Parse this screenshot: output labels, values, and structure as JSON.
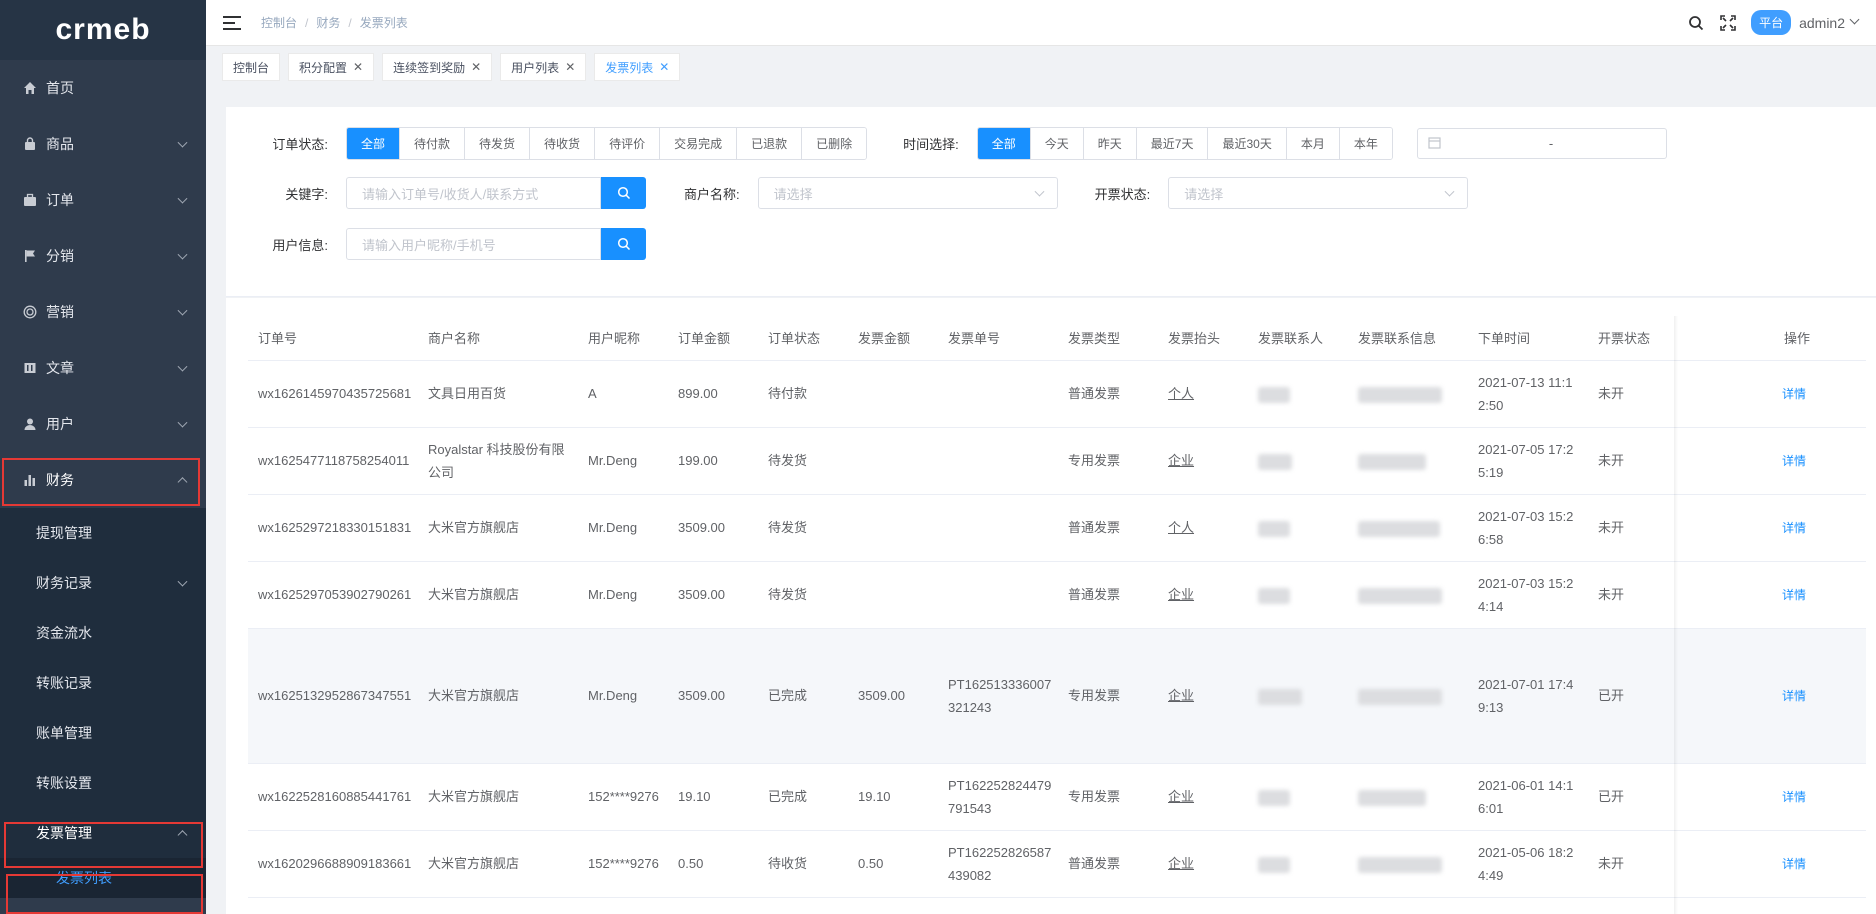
{
  "logo": "crmeb",
  "colors": {
    "accent": "#1890ff",
    "sidebar": "#2f3b4c",
    "highlight": "#e53935"
  },
  "sidebar": {
    "items": [
      {
        "label": "首页",
        "icon": "home-icon"
      },
      {
        "label": "商品",
        "icon": "bag-icon"
      },
      {
        "label": "订单",
        "icon": "briefcase-icon"
      },
      {
        "label": "分销",
        "icon": "flag-icon"
      },
      {
        "label": "营销",
        "icon": "target-icon"
      },
      {
        "label": "文章",
        "icon": "book-icon"
      },
      {
        "label": "用户",
        "icon": "user-icon"
      },
      {
        "label": "财务",
        "icon": "bar-chart-icon"
      }
    ],
    "finance_sub": [
      "提现管理",
      "财务记录",
      "资金流水",
      "转账记录",
      "账单管理",
      "转账设置",
      "发票管理"
    ],
    "invoice_sub": [
      "发票列表"
    ]
  },
  "header": {
    "breadcrumb": [
      "控制台",
      "财务",
      "发票列表"
    ],
    "platform": "平台",
    "user": "admin2"
  },
  "tags": [
    {
      "label": "控制台",
      "closable": false
    },
    {
      "label": "积分配置",
      "closable": true
    },
    {
      "label": "连续签到奖励",
      "closable": true
    },
    {
      "label": "用户列表",
      "closable": true
    },
    {
      "label": "发票列表",
      "closable": true,
      "active": true
    }
  ],
  "filters": {
    "order_status_label": "订单状态:",
    "order_status_options": [
      "全部",
      "待付款",
      "待发货",
      "待收货",
      "待评价",
      "交易完成",
      "已退款",
      "已删除"
    ],
    "time_label": "时间选择:",
    "time_options": [
      "全部",
      "今天",
      "昨天",
      "最近7天",
      "最近30天",
      "本月",
      "本年"
    ],
    "date_sep": "-",
    "keyword_label": "关键字:",
    "keyword_placeholder": "请输入订单号/收货人/联系方式",
    "merchant_label": "商户名称:",
    "merchant_placeholder": "请选择",
    "invoice_status_label": "开票状态:",
    "invoice_status_placeholder": "请选择",
    "user_label": "用户信息:",
    "user_placeholder": "请输入用户昵称/手机号"
  },
  "table": {
    "columns": [
      "订单号",
      "商户名称",
      "用户昵称",
      "订单金额",
      "订单状态",
      "发票金额",
      "发票单号",
      "发票类型",
      "发票抬头",
      "发票联系人",
      "发票联系信息",
      "下单时间",
      "开票状态",
      "操作"
    ],
    "rows": [
      {
        "order_no": "wx1626145970435725681",
        "merchant": "文具日用百货",
        "nickname": "A",
        "amount": "899.00",
        "status": "待付款",
        "inv_amount": "",
        "inv_no": "",
        "inv_type": "普通发票",
        "inv_title": "个人",
        "created": "2021-07-13 11:12:50",
        "inv_status": "未开",
        "action": "详情"
      },
      {
        "order_no": "wx1625477118758254011",
        "merchant": "Royalstar 科技股份有限公司",
        "nickname": "Mr.Deng",
        "amount": "199.00",
        "status": "待发货",
        "inv_amount": "",
        "inv_no": "",
        "inv_type": "专用发票",
        "inv_title": "企业",
        "created": "2021-07-05 17:25:19",
        "inv_status": "未开",
        "action": "详情"
      },
      {
        "order_no": "wx1625297218330151831",
        "merchant": "大米官方旗舰店",
        "nickname": "Mr.Deng",
        "amount": "3509.00",
        "status": "待发货",
        "inv_amount": "",
        "inv_no": "",
        "inv_type": "普通发票",
        "inv_title": "个人",
        "created": "2021-07-03 15:26:58",
        "inv_status": "未开",
        "action": "详情"
      },
      {
        "order_no": "wx1625297053902790261",
        "merchant": "大米官方旗舰店",
        "nickname": "Mr.Deng",
        "amount": "3509.00",
        "status": "待发货",
        "inv_amount": "",
        "inv_no": "",
        "inv_type": "普通发票",
        "inv_title": "企业",
        "created": "2021-07-03 15:24:14",
        "inv_status": "未开",
        "action": "详情"
      },
      {
        "order_no": "wx1625132952867347551",
        "merchant": "大米官方旗舰店",
        "nickname": "Mr.Deng",
        "amount": "3509.00",
        "status": "已完成",
        "inv_amount": "3509.00",
        "inv_no": "PT162513336007321243",
        "inv_type": "专用发票",
        "inv_title": "企业",
        "created": "2021-07-01 17:49:13",
        "inv_status": "已开",
        "action": "详情"
      },
      {
        "order_no": "wx1622528160885441761",
        "merchant": "大米官方旗舰店",
        "nickname": "152****9276",
        "amount": "19.10",
        "status": "已完成",
        "inv_amount": "19.10",
        "inv_no": "PT162252824479791543",
        "inv_type": "专用发票",
        "inv_title": "企业",
        "created": "2021-06-01 14:16:01",
        "inv_status": "已开",
        "action": "详情"
      },
      {
        "order_no": "wx1620296688909183661",
        "merchant": "大米官方旗舰店",
        "nickname": "152****9276",
        "amount": "0.50",
        "status": "待收货",
        "inv_amount": "0.50",
        "inv_no": "PT162252826587439082",
        "inv_type": "普通发票",
        "inv_title": "企业",
        "created": "2021-05-06 18:24:49",
        "inv_status": "未开",
        "action": "详情"
      }
    ]
  }
}
